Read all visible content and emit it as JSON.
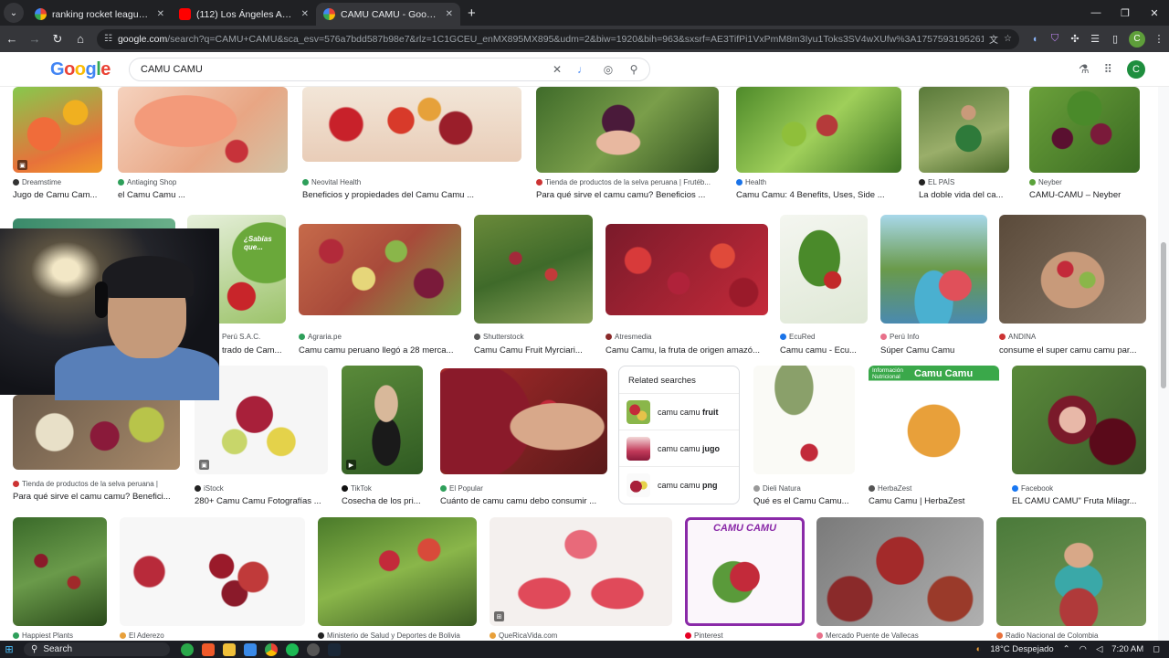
{
  "browser": {
    "tabs": [
      {
        "title": "ranking rocket league - Google",
        "favicon": "google-favicon",
        "active": false
      },
      {
        "title": "(112) Los Ángeles Azules - Nun",
        "favicon": "youtube-favicon",
        "active": false
      },
      {
        "title": "CAMU CAMU - Google Search",
        "favicon": "google-favicon",
        "active": true
      }
    ],
    "url_host": "google.com",
    "url_path": "/search?q=CAMU+CAMU&sca_esv=576a7bdd587b98e7&rlz=1C1GCEU_enMX895MX895&udm=2&biw=1920&bih=963&sxsrf=AE3TifPi1VxPmM8m3Iyu1Toks3SV4wXUfw%3A1757593195261&ei=a77CaNbfD4_KkPI...",
    "profile_initial": "C"
  },
  "google": {
    "query": "CAMU CAMU",
    "account_initial": "C"
  },
  "results": {
    "row1": [
      {
        "source": "Dreamstime",
        "caption": "Jugo de Camu Cam..."
      },
      {
        "source": "Antiaging Shop",
        "caption": "el Camu Camu ..."
      },
      {
        "source": "Neovital Health",
        "caption": "Beneficios y propiedades del Camu Camu ..."
      },
      {
        "source": "Tienda de productos de la selva peruana | Frutéb...",
        "caption": "Para qué sirve el camu camu? Beneficios ..."
      },
      {
        "source": "Health",
        "caption": "Camu Camu: 4 Benefits, Uses, Side ..."
      },
      {
        "source": "EL PAÍS",
        "caption": "La doble vida del ca..."
      },
      {
        "source": "Neyber",
        "caption": "CAMU-CAMU – Neyber"
      }
    ],
    "row2": [
      {
        "source": "Perú S.A.C.",
        "caption": "trado de Cam..."
      },
      {
        "source": "Agraria.pe",
        "caption": "Camu camu peruano llegó a 28 merca..."
      },
      {
        "source": "Shutterstock",
        "caption": "Camu Camu Fruit Myrciari..."
      },
      {
        "source": "Atresmedia",
        "caption": "Camu Camu, la fruta de origen amazó..."
      },
      {
        "source": "EcuRed",
        "caption": "Camu camu - Ecu..."
      },
      {
        "source": "Perú Info",
        "caption": "Súper Camu Camu"
      },
      {
        "source": "ANDINA",
        "caption": "consume el super camu camu par..."
      }
    ],
    "row3": [
      {
        "source": "Tienda de productos de la selva peruana |",
        "caption": "Para qué sirve el camu camu? Benefici..."
      },
      {
        "source": "iStock",
        "caption": "280+ Camu Camu Fotografías ..."
      },
      {
        "source": "TikTok",
        "caption": "Cosecha de los pri..."
      },
      {
        "source": "El Popular",
        "caption": "Cuánto de camu camu debo consumir ..."
      },
      {
        "source": "Dieli Natura",
        "caption": "Qué es el Camu Camu..."
      },
      {
        "source": "HerbaZest",
        "caption": "Camu Camu | HerbaZest"
      },
      {
        "source": "Facebook",
        "caption": "EL CAMU CAMU\" Fruta Milagr..."
      }
    ],
    "row4": [
      {
        "source": "Happiest Plants"
      },
      {
        "source": "El Aderezo"
      },
      {
        "source": "Ministerio de Salud y Deportes de Bolivia"
      },
      {
        "source": "QueRicaVida.com"
      },
      {
        "source": "Pinterest"
      },
      {
        "source": "Mercado Puente de Vallecas"
      },
      {
        "source": "Radio Nacional de Colombia"
      }
    ],
    "thumb_texts": {
      "sabias": "¿Sabías que...",
      "nutrition": "Información Nutricional",
      "nutrition_title": "Camu Camu",
      "poster": "CAMU CAMU"
    }
  },
  "related": {
    "title": "Related searches",
    "items": [
      {
        "prefix": "camu camu ",
        "bold": "fruit"
      },
      {
        "prefix": "camu camu ",
        "bold": "jugo"
      },
      {
        "prefix": "camu camu ",
        "bold": "png"
      }
    ]
  },
  "taskbar": {
    "search_label": "Search",
    "weather": "18°C  Despejado",
    "time": "7:20 AM"
  }
}
